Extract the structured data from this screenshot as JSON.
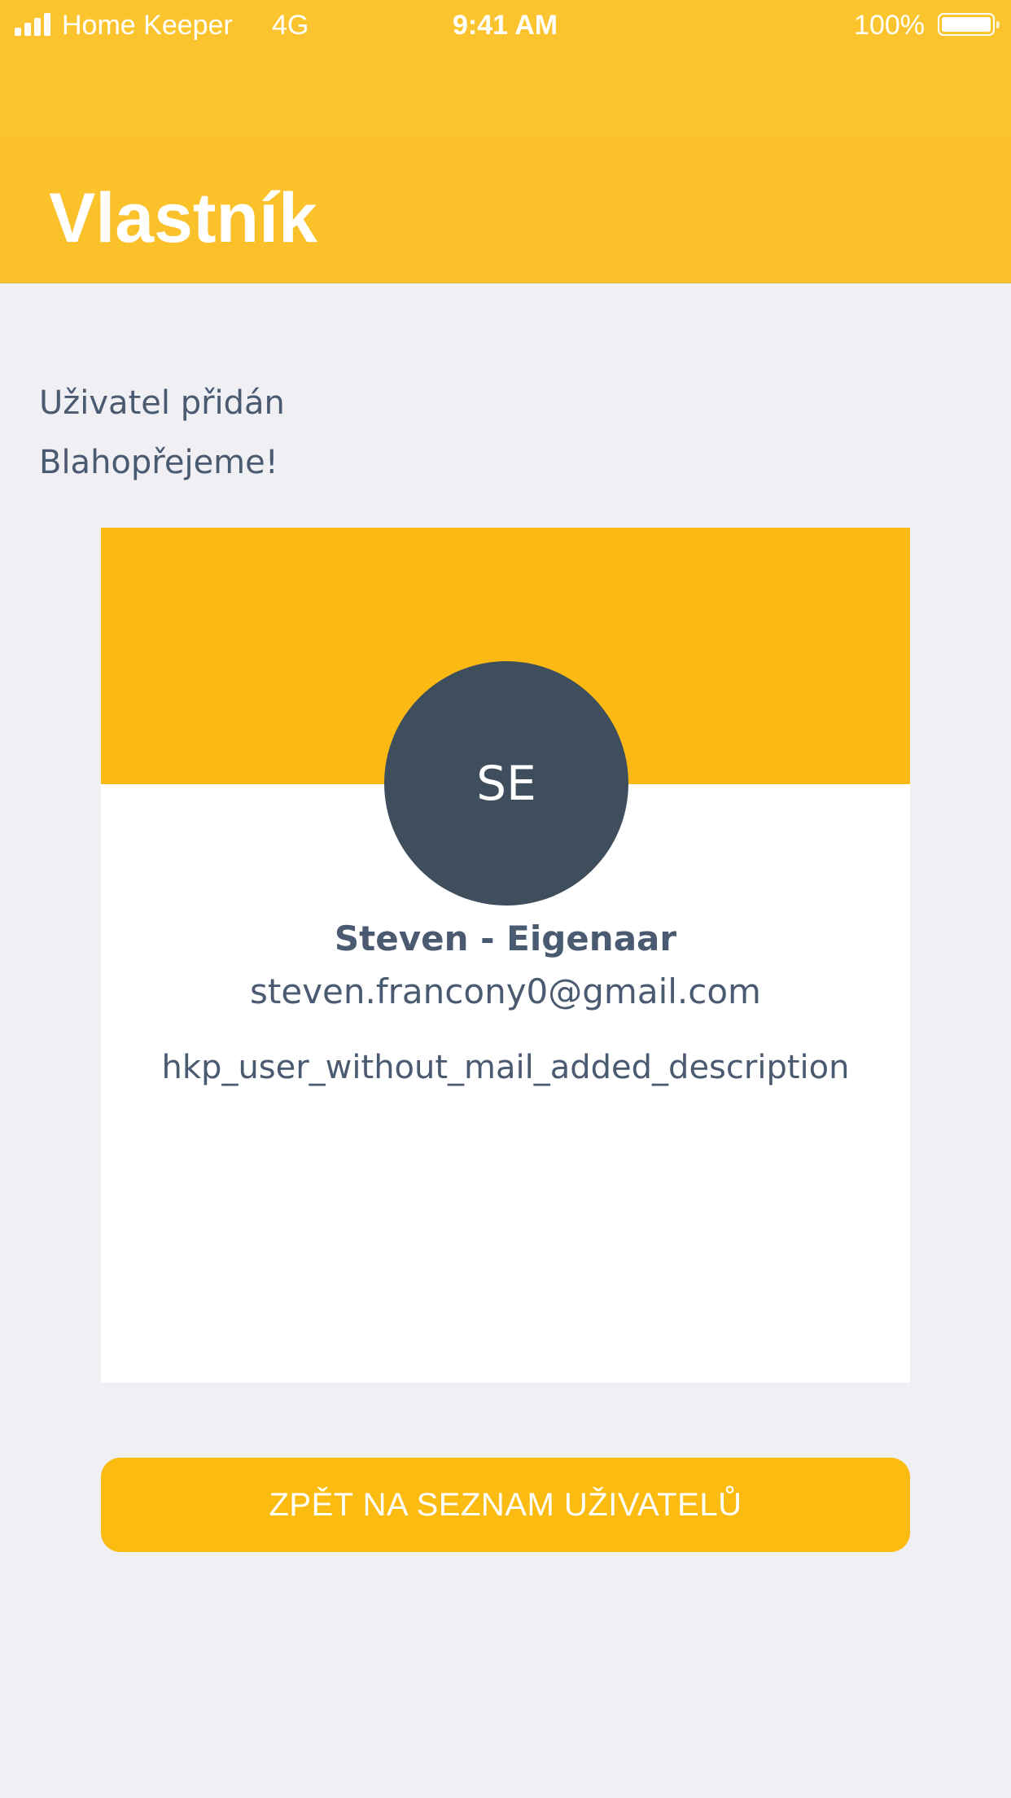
{
  "status_bar": {
    "carrier": "Home Keeper",
    "network": "4G",
    "time": "9:41 AM",
    "battery": "100%"
  },
  "header": {
    "title": "Vlastník"
  },
  "messages": {
    "line1": "Uživatel přidán",
    "line2": "Blahopřejeme!"
  },
  "user_card": {
    "initials": "SE",
    "name": "Steven - Eigenaar",
    "email": "steven.francony0@gmail.com",
    "description": "hkp_user_without_mail_added_description"
  },
  "actions": {
    "back_label": "ZPĚT NA SEZNAM UŽIVATELŮ"
  },
  "colors": {
    "header": "#fbc02a",
    "banner": "#fdb913",
    "button": "#fbbb10",
    "avatar": "#3f4e5c",
    "text": "#4a5a70",
    "background": "#efeff4"
  }
}
